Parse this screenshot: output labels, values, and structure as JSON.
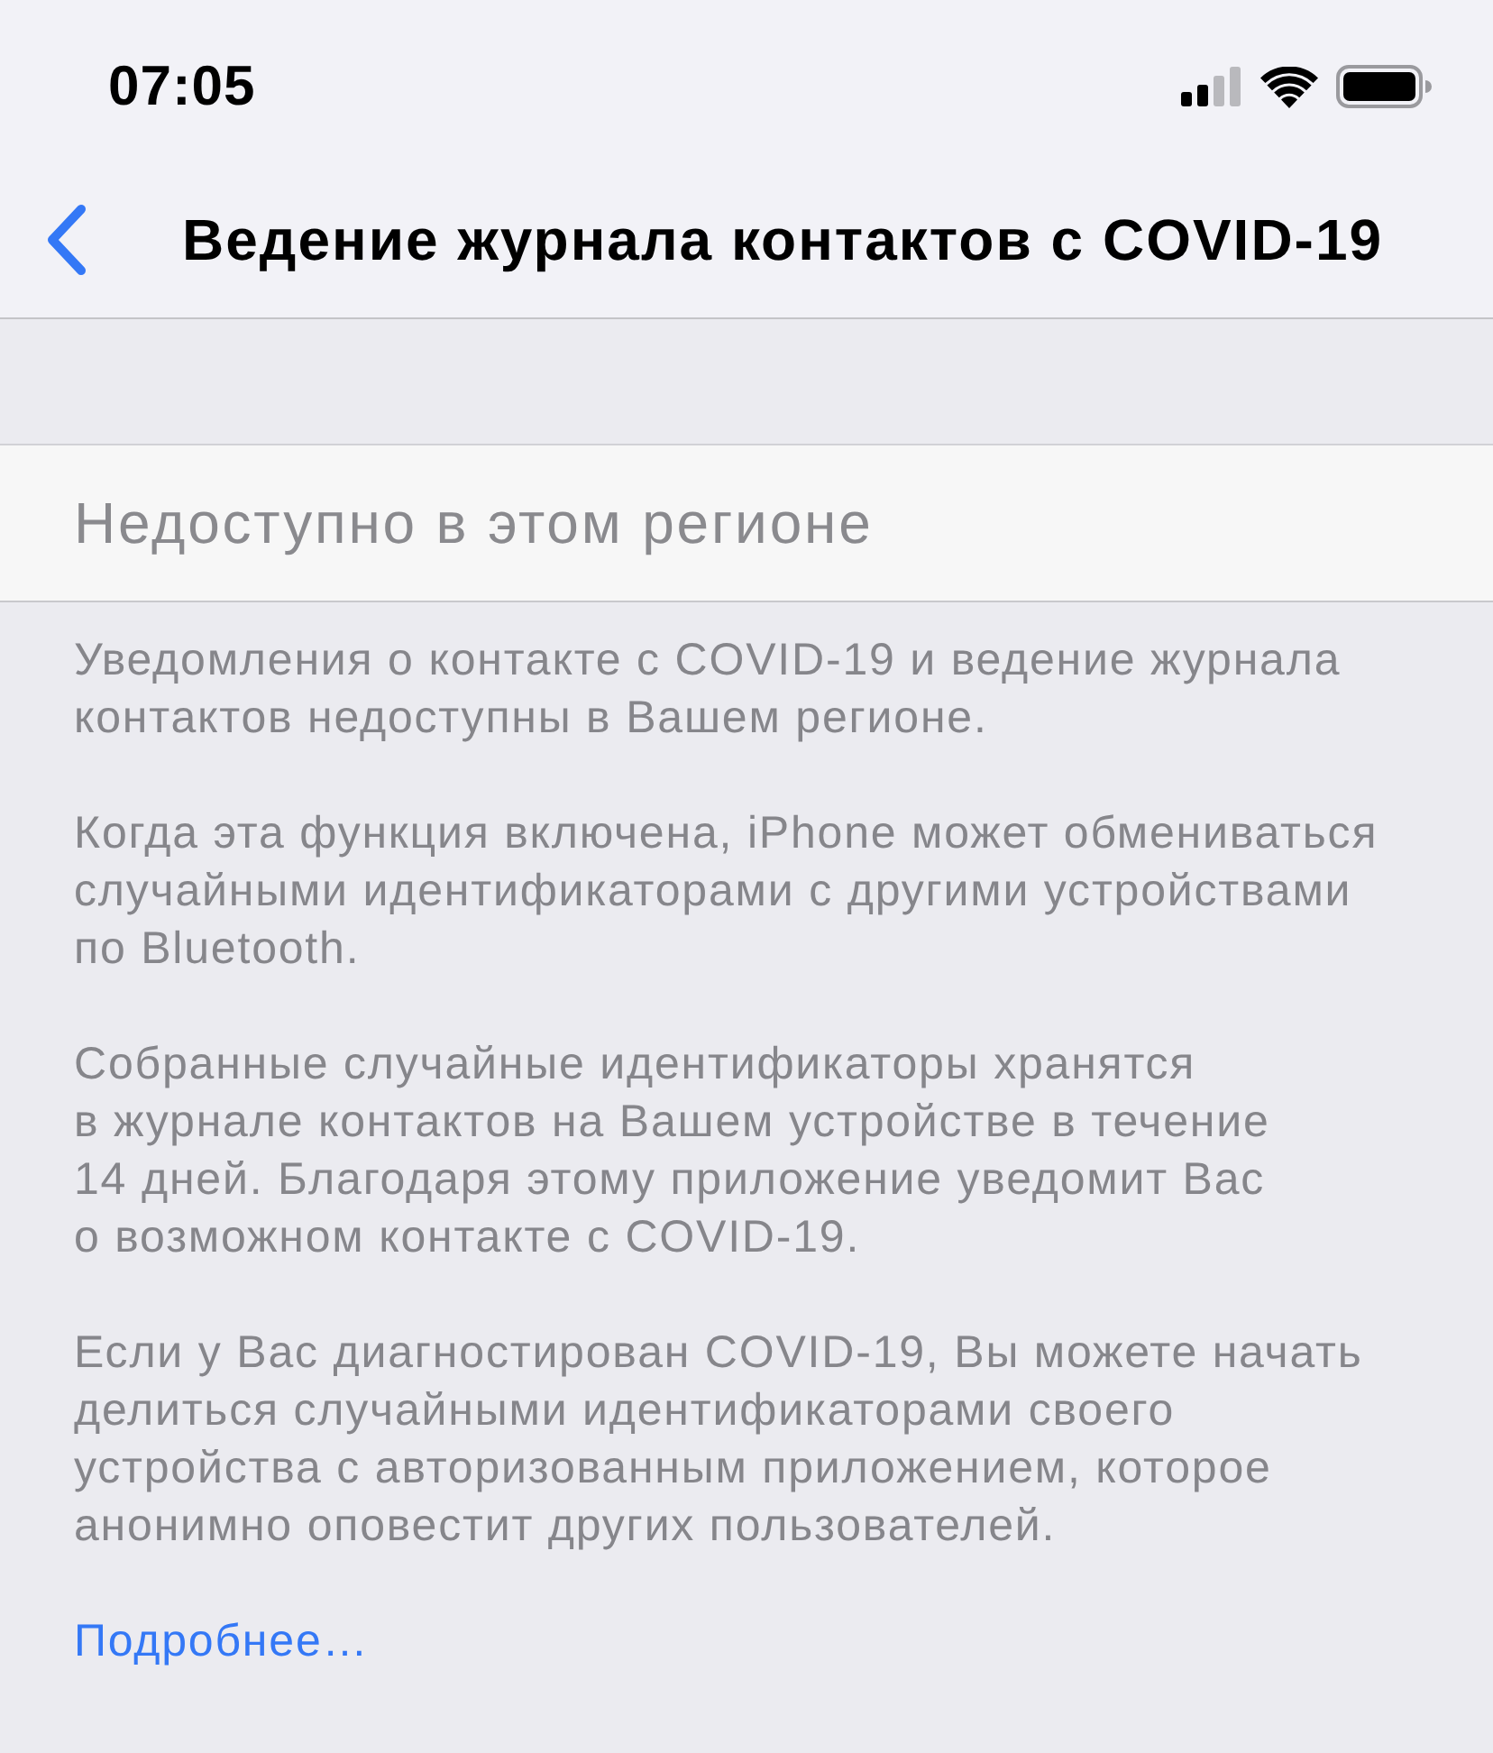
{
  "status_bar": {
    "time": "07:05"
  },
  "nav_bar": {
    "title": "Ведение журнала контактов с COVID-19"
  },
  "cell": {
    "label": "Недоступно в этом регионе",
    "disabled": true
  },
  "footer": {
    "paragraphs": [
      {
        "lines": [
          "Уведомления о контакте с COVID-19 и ведение журнала",
          "контактов недоступны в Вашем регионе."
        ]
      },
      {
        "lines": [
          "Когда эта функция включена, iPhone может обмениваться",
          "случайными идентификаторами с другими устройствами",
          "по Bluetooth."
        ]
      },
      {
        "lines": [
          "Собранные случайные идентификаторы хранятся",
          "в журнале контактов на Вашем устройстве в течение",
          "14 дней. Благодаря этому приложение уведомит Вас",
          "о возможном контакте с COVID-19."
        ]
      },
      {
        "lines": [
          "Если у Вас диагностирован COVID-19, Вы можете начать",
          "делиться случайными идентификаторами своего",
          "устройства с авторизованным приложением, которое",
          "анонимно оповестит других пользователей."
        ]
      }
    ],
    "link": "Подробнее…"
  }
}
